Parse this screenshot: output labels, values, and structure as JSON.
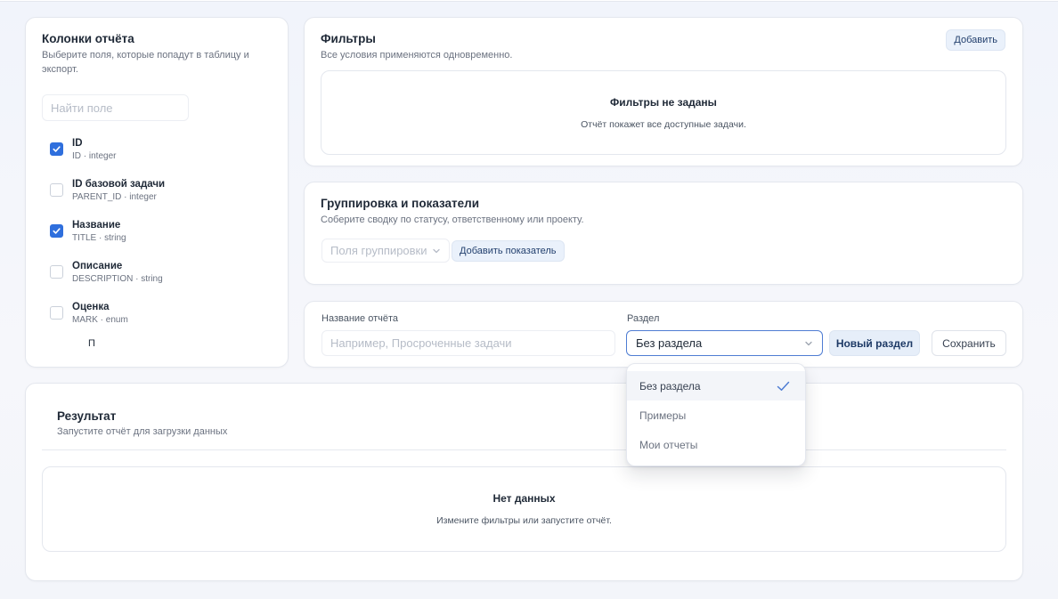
{
  "columns_panel": {
    "title": "Колонки отчёта",
    "subtitle": "Выберите поля, которые попадут в таблицу и экспорт.",
    "search_placeholder": "Найти поле",
    "items": [
      {
        "name": "ID",
        "meta": "ID · integer",
        "checked": true
      },
      {
        "name": "ID базовой задачи",
        "meta": "PARENT_ID · integer",
        "checked": false
      },
      {
        "name": "Название",
        "meta": "TITLE · string",
        "checked": true
      },
      {
        "name": "Описание",
        "meta": "DESCRIPTION · string",
        "checked": false
      },
      {
        "name": "Оценка",
        "meta": "MARK · enum",
        "checked": false
      }
    ],
    "partial_item": "П"
  },
  "filters": {
    "title": "Фильтры",
    "subtitle": "Все условия применяются одновременно.",
    "add_label": "Добавить",
    "empty_title": "Фильтры не заданы",
    "empty_text": "Отчёт покажет все доступные задачи."
  },
  "grouping": {
    "title": "Группировка и показатели",
    "subtitle": "Соберите сводку по статусу, ответственному или проекту.",
    "group_fields_placeholder": "Поля группировки",
    "add_metric_label": "Добавить показатель"
  },
  "report": {
    "name_label": "Название отчёта",
    "name_placeholder": "Например, Просроченные задачи",
    "section_label": "Раздел",
    "section_value": "Без раздела",
    "new_section_label": "Новый раздел",
    "save_label": "Сохранить"
  },
  "section_dropdown": {
    "options": [
      {
        "label": "Без раздела",
        "selected": true
      },
      {
        "label": "Примеры",
        "selected": false
      },
      {
        "label": "Мои отчеты",
        "selected": false
      }
    ]
  },
  "result": {
    "title": "Результат",
    "subtitle": "Запустите отчёт для загрузки данных",
    "empty_title": "Нет данных",
    "empty_text": "Измените фильтры или запустите отчёт."
  },
  "colors": {
    "accent": "#2f6fdd",
    "light_button_bg": "#eaf1fb",
    "border": "#e4e7ee"
  },
  "icons": [
    "check-icon",
    "chevron-down-icon",
    "checkmark-icon"
  ]
}
